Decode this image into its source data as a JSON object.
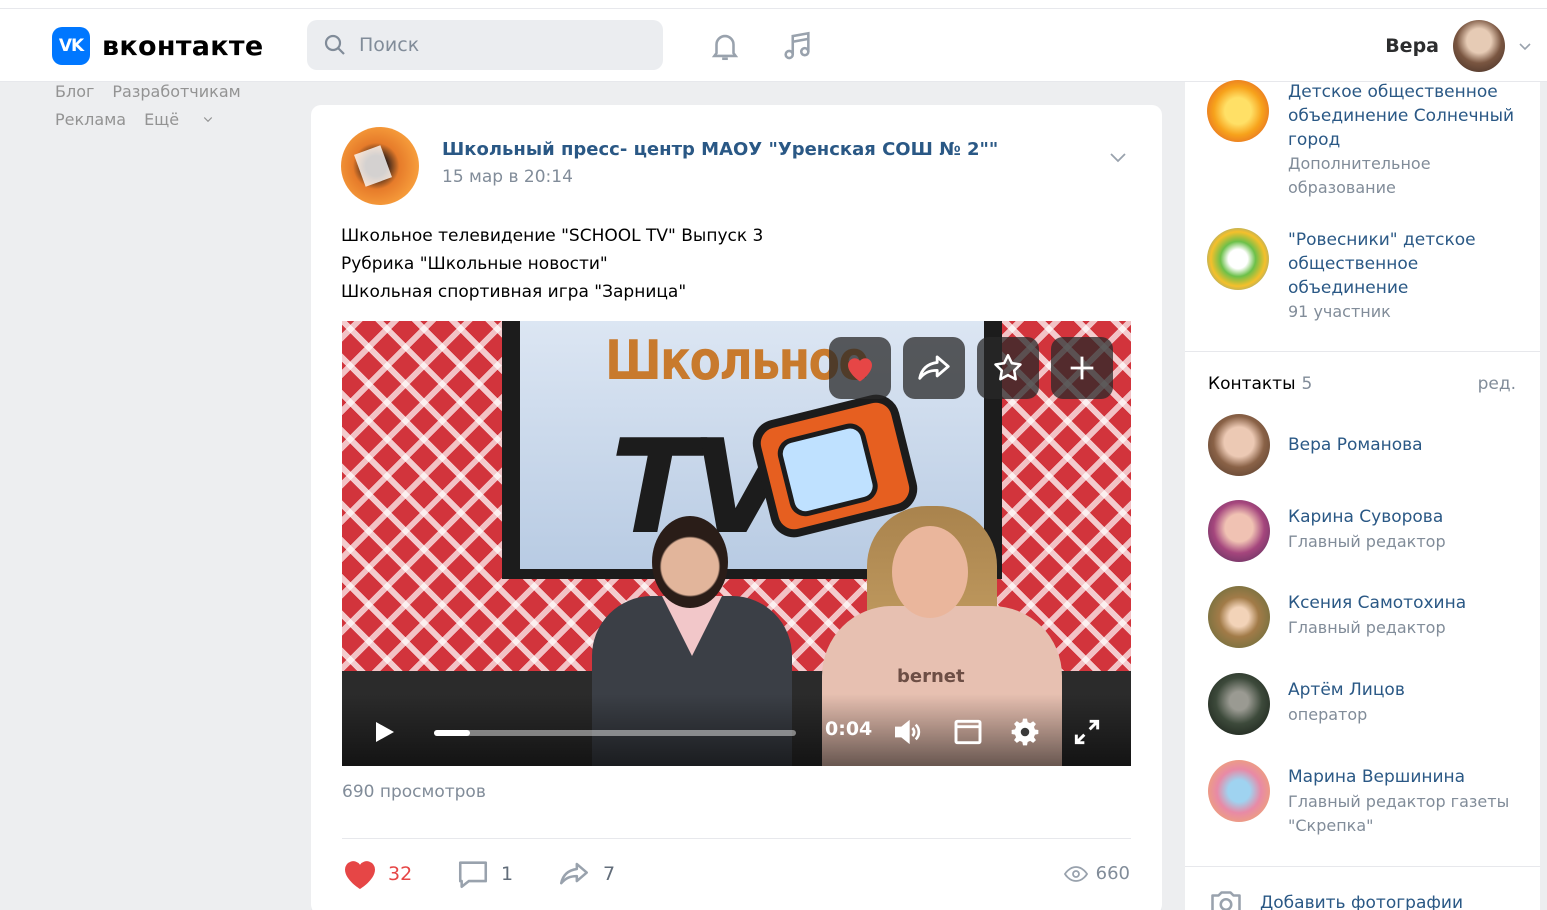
{
  "header": {
    "logo_mark": "VK",
    "logo_text": "вконтакте",
    "search_placeholder": "Поиск",
    "user_name": "Вера"
  },
  "left_menu": {
    "links": [
      "Блог",
      "Разработчикам",
      "Реклама",
      "Ещё"
    ]
  },
  "post": {
    "author": "Школьный пресс- центр МАОУ \"Уренская СОШ № 2\"\"",
    "date": "15 мар в 20:14",
    "text_lines": [
      "Школьное телевидение \"SCHOOL TV\" Выпуск 3",
      "Рубрика \"Школьные новости\"",
      "Школьная спортивная игра \"Зарница\""
    ],
    "video": {
      "frame_title": "Школьное",
      "frame_logo": "TV",
      "sweatshirt_text": "bernet",
      "timecode": "0:04",
      "progress": 0.1
    },
    "views_label": "690 просмотров",
    "likes": "32",
    "comments": "1",
    "shares": "7",
    "seen_count": "660"
  },
  "sidebar": {
    "groups": [
      {
        "name": "Детское общественное объединение Солнечный город",
        "sub": "Дополнительное образование"
      },
      {
        "name": "\"Ровесники\" детское общественное объединение",
        "sub": "91 участник"
      }
    ],
    "contacts_title": "Контакты",
    "contacts_count": "5",
    "contacts_edit": "ред.",
    "contacts": [
      {
        "name": "Вера Романова",
        "role": ""
      },
      {
        "name": "Карина Суворова",
        "role": "Главный редактор"
      },
      {
        "name": "Ксения Самотохина",
        "role": "Главный редактор"
      },
      {
        "name": "Артём Лицов",
        "role": "оператор"
      },
      {
        "name": "Марина Вершинина",
        "role": "Главный редактор газеты \"Скрепка\""
      }
    ],
    "add_photo": "Добавить фотографии"
  },
  "colors": {
    "accent": "#0077ff",
    "link": "#2a5885",
    "like": "#e64646",
    "background": "#edeef0"
  }
}
